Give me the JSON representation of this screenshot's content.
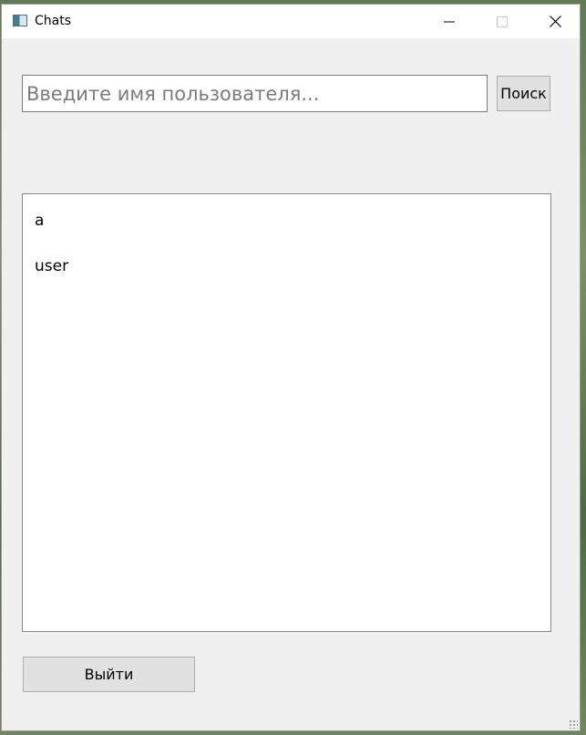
{
  "window": {
    "title": "Chats",
    "icons": {
      "app": "app-window-icon",
      "minimize": "minimize-icon",
      "maximize": "maximize-icon",
      "close": "close-icon"
    }
  },
  "search": {
    "placeholder": "Введите имя пользователя...",
    "value": "",
    "button_label": "Поиск"
  },
  "users": {
    "items": [
      {
        "label": "a"
      },
      {
        "label": "user"
      }
    ]
  },
  "footer": {
    "logout_label": "Выйти"
  }
}
